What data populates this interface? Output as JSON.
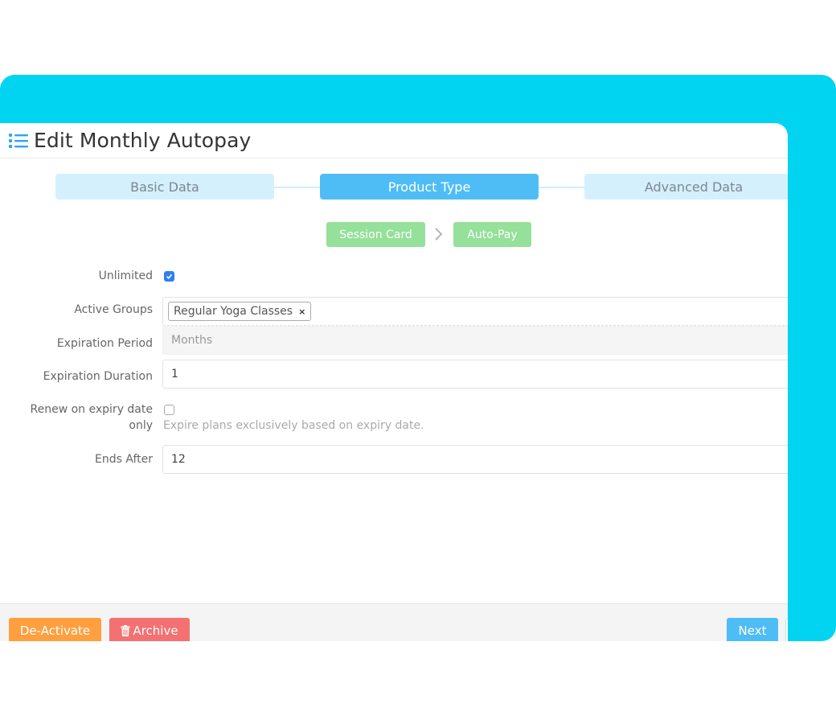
{
  "header": {
    "icon": "list-icon",
    "title": "Edit Monthly Autopay"
  },
  "steps": [
    {
      "label": "Basic Data",
      "active": false
    },
    {
      "label": "Product Type",
      "active": true
    },
    {
      "label": "Advanced Data",
      "active": false
    }
  ],
  "product_path": {
    "items": [
      "Session Card",
      "Auto-Pay"
    ],
    "separator_icon": "chevron-right-icon"
  },
  "form": {
    "unlimited": {
      "label": "Unlimited",
      "checked": true
    },
    "active_groups": {
      "label": "Active Groups",
      "tags": [
        "Regular Yoga Classes"
      ],
      "remove_glyph": "×"
    },
    "expiration_period": {
      "label": "Expiration Period",
      "value": "Months",
      "disabled": true
    },
    "expiration_duration": {
      "label": "Expiration Duration",
      "value": "1"
    },
    "renew_on_expiry": {
      "label_line1": "Renew on expiry date",
      "label_line2": "only",
      "checked": false,
      "help": "Expire plans exclusively based on expiry date."
    },
    "ends_after": {
      "label": "Ends After",
      "value": "12"
    }
  },
  "footer": {
    "deactivate_label": "De-Activate",
    "archive_label": "Archive",
    "next_label": "Next"
  },
  "colors": {
    "backdrop": "#00d4f0",
    "step_active": "#4fbdf5",
    "step_inactive": "#d4f0fd",
    "pill_green": "#95e09a",
    "deactivate": "#ff9f3f",
    "archive": "#f47171",
    "checkbox_checked": "#2f7ff0"
  }
}
